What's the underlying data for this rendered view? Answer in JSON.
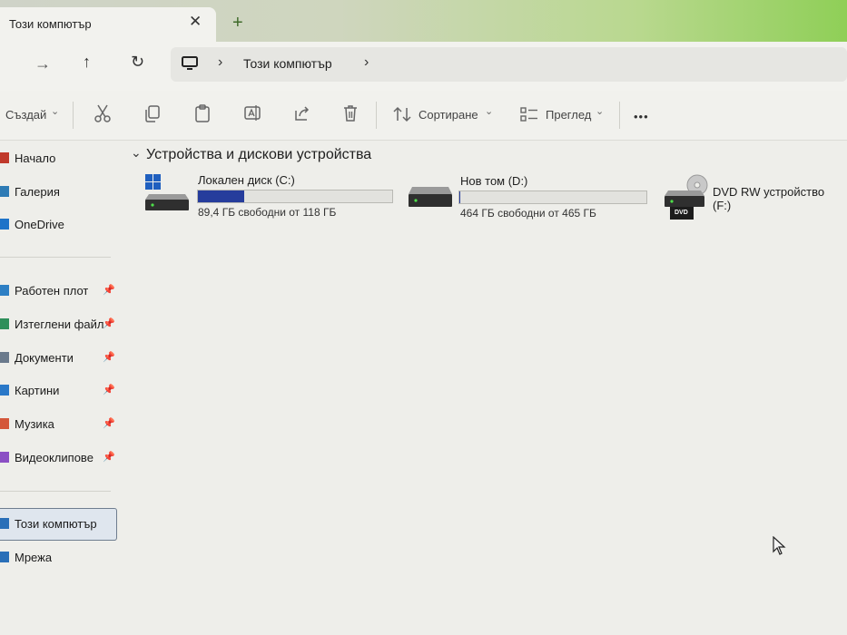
{
  "window": {
    "tab_title": "Този компютър",
    "tab_close": "✕",
    "tab_add": "+"
  },
  "nav": {
    "forward_icon": "→",
    "up_icon": "↑",
    "refresh_icon": "↻",
    "breadcrumb_sep": "›",
    "breadcrumb": "Този компютър",
    "breadcrumb_more": "›"
  },
  "toolbar": {
    "new_label": "Създай",
    "sort_label": "Сортиране",
    "view_label": "Преглед",
    "more_label": "•••",
    "chevron": "⌄"
  },
  "sidebar": {
    "items": [
      {
        "label": "Начало",
        "icon": "home-icon",
        "color": "#c0392b"
      },
      {
        "label": "Галерия",
        "icon": "gallery-icon",
        "color": "#2e7bb5"
      },
      {
        "label": "OneDrive",
        "icon": "cloud-icon",
        "color": "#1e73c8"
      },
      {
        "label": "Работен плот",
        "icon": "desktop-icon",
        "color": "#2d7fc4",
        "pinned": true
      },
      {
        "label": "Изтеглени файл",
        "icon": "download-icon",
        "color": "#2e8f5a",
        "pinned": true
      },
      {
        "label": "Документи",
        "icon": "documents-icon",
        "color": "#6a7a8c",
        "pinned": true
      },
      {
        "label": "Картини",
        "icon": "pictures-icon",
        "color": "#2a78c8",
        "pinned": true
      },
      {
        "label": "Музика",
        "icon": "music-icon",
        "color": "#d4573a",
        "pinned": true
      },
      {
        "label": "Видеоклипове",
        "icon": "video-icon",
        "color": "#8b4fc4",
        "pinned": true
      },
      {
        "label": "Този компютър",
        "icon": "computer-icon",
        "color": "#2a6fb8",
        "selected": true
      },
      {
        "label": "Мрежа",
        "icon": "network-icon",
        "color": "#2a6fb8"
      }
    ],
    "pin_glyph": "📌"
  },
  "section": {
    "title": "Устройства и дискови устройства",
    "chevron": "⌄"
  },
  "drives": [
    {
      "name": "Локален диск (C:)",
      "free_text": "89,4 ГБ свободни от 118 ГБ",
      "used_fraction": 0.24,
      "icon": "windows-drive-icon"
    },
    {
      "name": "Нов том (D:)",
      "free_text": "464 ГБ свободни от 465 ГБ",
      "used_fraction": 0.002,
      "icon": "hard-drive-icon"
    },
    {
      "name": "DVD RW устройство (F:)",
      "badge": "DVD",
      "icon": "dvd-drive-icon"
    }
  ],
  "colors": {
    "accent_fill": "#263d9c",
    "selection_bg": "#dfe6ee"
  }
}
